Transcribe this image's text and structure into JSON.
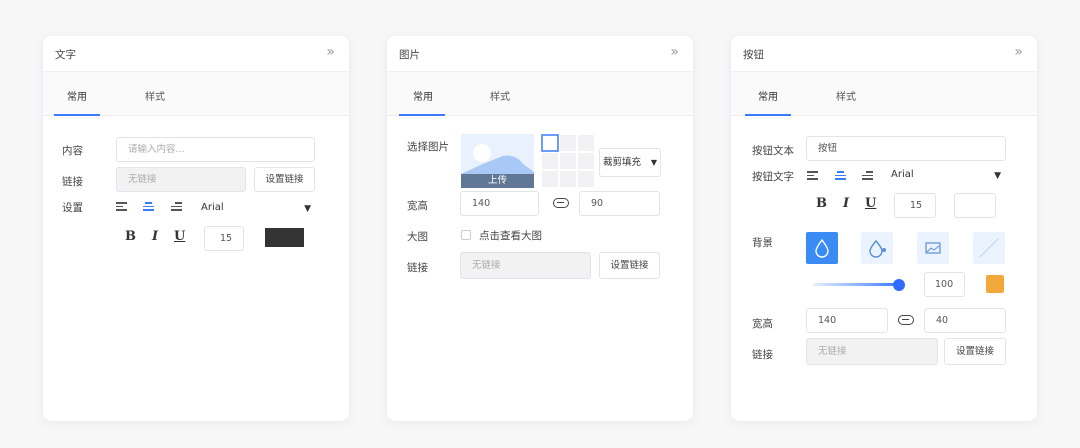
{
  "colors": {
    "accent": "#3b7bff",
    "text_color_swatch": "#333333",
    "bg_color_swatch": "#f2a93b",
    "active_bg": "#3b8bf5"
  },
  "panel_text": {
    "title": "文字",
    "tabs": [
      {
        "label": "常用"
      },
      {
        "label": "样式"
      }
    ],
    "content_label": "内容",
    "content_placeholder": "请输入内容...",
    "link_label": "链接",
    "link_value": "无链接",
    "set_link_button": "设置链接",
    "settings_label": "设置",
    "font_family": "Arial",
    "bold": "B",
    "italic": "I",
    "underline": "U",
    "font_size": "15"
  },
  "panel_image": {
    "title": "图片",
    "tabs": [
      {
        "label": "常用"
      },
      {
        "label": "样式"
      }
    ],
    "select_label": "选择图片",
    "upload_label": "上传",
    "fit_mode": "裁剪填充",
    "size_label": "宽高",
    "width": "140",
    "height": "90",
    "large_label": "大图",
    "view_large_label": "点击查看大图",
    "link_label": "链接",
    "link_value": "无链接",
    "set_link_button": "设置链接"
  },
  "panel_button": {
    "title": "按钮",
    "tabs": [
      {
        "label": "常用"
      },
      {
        "label": "样式"
      }
    ],
    "btn_text_label": "按钮文本",
    "btn_text_value": "按钮",
    "btn_font_label": "按钮文字",
    "font_family": "Arial",
    "bold": "B",
    "italic": "I",
    "underline": "U",
    "font_size": "15",
    "bg_label": "背景",
    "opacity": "100",
    "size_label": "宽高",
    "width": "140",
    "height": "40",
    "link_label": "链接",
    "link_value": "无链接",
    "set_link_button": "设置链接"
  }
}
